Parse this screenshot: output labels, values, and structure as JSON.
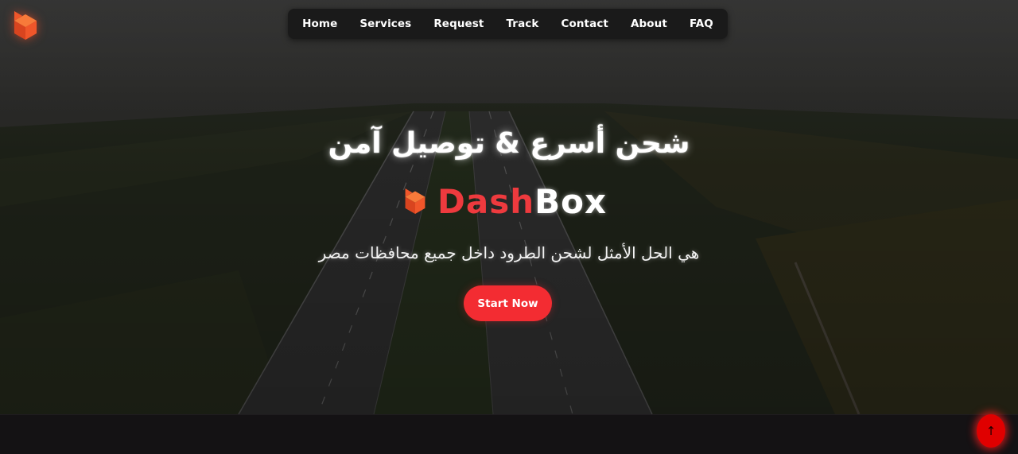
{
  "nav": {
    "items": [
      "Home",
      "Services",
      "Request",
      "Track",
      "Contact",
      "About",
      "FAQ"
    ]
  },
  "hero": {
    "title": "شحن أسرع & توصيل آمن",
    "brand_part1": "Dash",
    "brand_part2": "Box",
    "subtitle": "هي الحل الأمثل لشحن الطرود داخل جميع محافظات مصر",
    "cta_label": "Start Now"
  },
  "scroll_top": {
    "glyph": "↑"
  },
  "icons": {
    "corner_logo": "dashbox-logo-icon",
    "brand_logo": "dashbox-logo-icon",
    "scroll_top": "arrow-up-icon"
  },
  "colors": {
    "accent": "#f32c32",
    "brand_red": "#ee3a3e",
    "logo_orange": "#f0562a",
    "navbar_bg": "#1a1a1a",
    "footer_bg": "#141214"
  }
}
